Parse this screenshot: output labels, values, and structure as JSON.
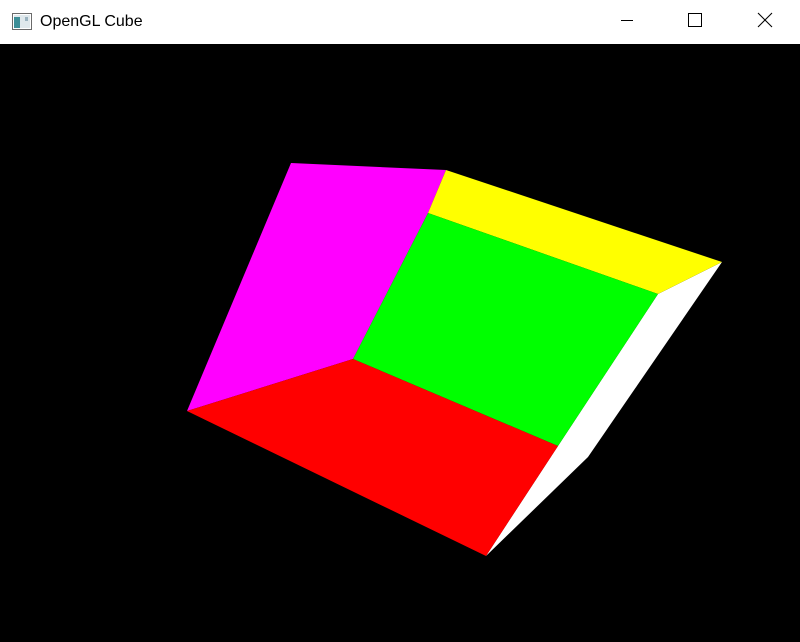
{
  "window": {
    "title": "OpenGL Cube",
    "app_icon": "window-app-icon",
    "controls": {
      "minimize_icon": "minimize-icon",
      "maximize_icon": "maximize-icon",
      "close_icon": "close-icon"
    }
  },
  "scene": {
    "background": "#000000",
    "faces": [
      {
        "name": "magenta-face",
        "color": "#ff00ff"
      },
      {
        "name": "yellow-face",
        "color": "#ffff00"
      },
      {
        "name": "green-face",
        "color": "#00ff00"
      },
      {
        "name": "red-face",
        "color": "#ff0000"
      },
      {
        "name": "white-face",
        "color": "#ffffff"
      }
    ]
  }
}
